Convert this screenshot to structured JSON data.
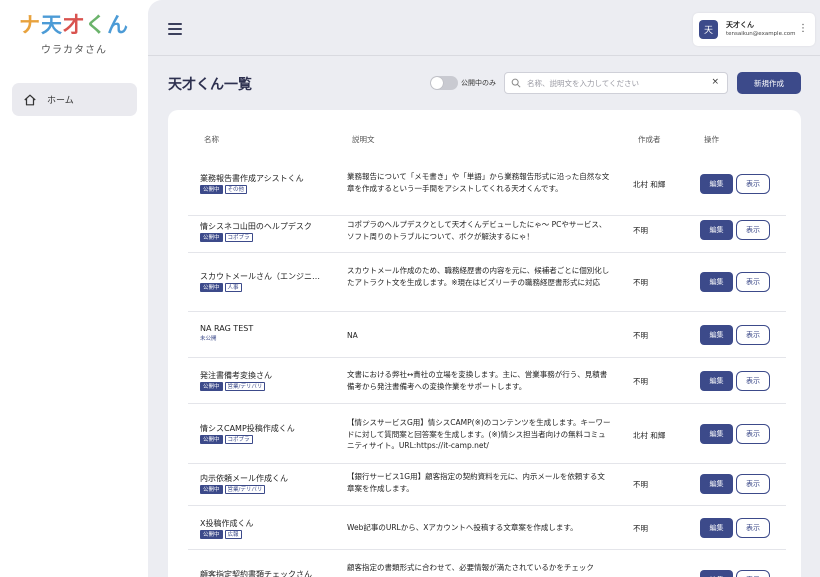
{
  "sidebar": {
    "logo": {
      "char1": "ナ",
      "char2": "天",
      "char3": "才",
      "char4": "く",
      "char5": "ん",
      "sub": "ウラカタさん"
    },
    "nav": [
      {
        "label": "ホーム",
        "icon": "home-icon"
      }
    ]
  },
  "header": {
    "user": {
      "avatar": "天",
      "name": "天才くん",
      "email": "tensaikun@example.com"
    }
  },
  "page": {
    "title": "天才くん一覧",
    "toggle_label": "公開中のみ",
    "search_placeholder": "名称、説明文を入力してください",
    "clear_label": "×",
    "new_button": "新規作成"
  },
  "table": {
    "headers": {
      "name": "名称",
      "description": "説明文",
      "creator": "作成者",
      "actions": "操作"
    },
    "edit_label": "編集",
    "view_label": "表示",
    "rows": [
      {
        "name": "業務報告書作成アシストくん",
        "status": "公開中",
        "category": "その他",
        "description": "業務報告について「メモ書き」や「単語」から業務報告形式に沿った自然な文章を作成するという一手間をアシストしてくれる天才くんです。",
        "creator": "北村 和輝"
      },
      {
        "name": "情シスネコ山田のヘルプデスク",
        "status": "公開中",
        "category": "コポプラ",
        "description": "コポプラのヘルプデスクとして天才くんデビューしたにゃ〜 PCやサービス、ソフト周りのトラブルについて、ボクが解決するにゃ！",
        "creator": "不明"
      },
      {
        "name": "スカウトメールさん（エンジニ…",
        "status": "公開中",
        "category": "人事",
        "description": "スカウトメール作成のため、職務経歴書の内容を元に、候補者ごとに個別化したアトラクト文を生成します。※現在はビズリーチの職務経歴書形式に対応",
        "creator": "不明"
      },
      {
        "name": "NA RAG TEST",
        "status": "未公開",
        "category": "",
        "description": "NA",
        "creator": "不明"
      },
      {
        "name": "発注書備考変換さん",
        "status": "公開中",
        "category": "営業/デリバリ",
        "description": "文書における弊社↔貴社の立場を変換します。主に、営業事務が行う、見積書備考から発注書備考への変換作業をサポートします。",
        "creator": "不明"
      },
      {
        "name": "情シスCAMP投稿作成くん",
        "status": "公開中",
        "category": "コポプラ",
        "description": "【情シスサービスG用】情シスCAMP(※)のコンテンツを生成します。キーワードに対して質問案と回答案を生成します。(※)情シス担当者向けの無料コミュニティサイト。URL:https://it-camp.net/",
        "creator": "北村 和輝"
      },
      {
        "name": "内示依頼メール作成くん",
        "status": "公開中",
        "category": "営業/デリバリ",
        "description": "【銀行サービス1G用】顧客指定の契約資料を元に、内示メールを依頼する文章案を作成します。",
        "creator": "不明"
      },
      {
        "name": "X投稿作成くん",
        "status": "公開中",
        "category": "広報",
        "description": "Web記事のURLから、Xアカウントへ投稿する文章案を作成します。",
        "creator": "不明"
      },
      {
        "name": "顧客指定契約書類チェックさん",
        "status": "",
        "category": "",
        "description": "顧客指定の書類形式に合わせて、必要情報が満たされているかをチェック",
        "creator": ""
      }
    ]
  }
}
